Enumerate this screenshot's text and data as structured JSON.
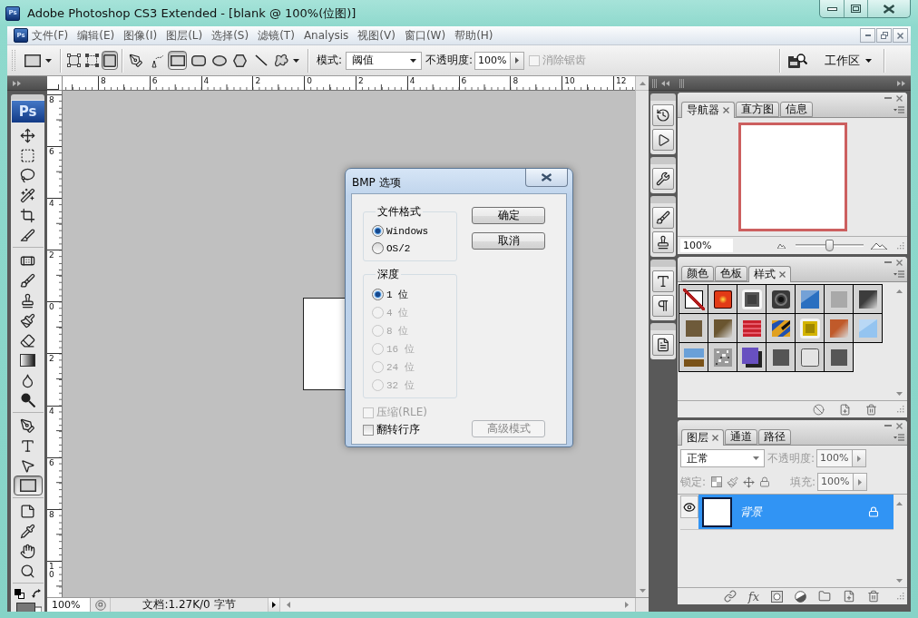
{
  "window": {
    "icon": "Ps",
    "title": "Adobe Photoshop CS3 Extended - [blank @ 100%(位图)]"
  },
  "menu_bar": {
    "icon": "Ps",
    "items": [
      "文件(F)",
      "编辑(E)",
      "图像(I)",
      "图层(L)",
      "选择(S)",
      "滤镜(T)",
      "Analysis",
      "视图(V)",
      "窗口(W)",
      "帮助(H)"
    ]
  },
  "options_bar": {
    "path_modes": [
      {
        "kind": "shape-layers",
        "selected": false
      },
      {
        "kind": "paths",
        "selected": false
      },
      {
        "kind": "fill-pixels",
        "selected": true
      }
    ],
    "shape_tools": [
      {
        "kind": "pen",
        "selected": false
      },
      {
        "kind": "freeform-pen",
        "selected": false
      },
      {
        "kind": "rectangle",
        "selected": true
      },
      {
        "kind": "rounded-rectangle",
        "selected": false
      },
      {
        "kind": "ellipse",
        "selected": false
      },
      {
        "kind": "polygon",
        "selected": false
      },
      {
        "kind": "line",
        "selected": false
      },
      {
        "kind": "custom-shape",
        "selected": false
      }
    ],
    "mode": {
      "label": "模式:",
      "value": "阈值"
    },
    "opacity": {
      "label": "不透明度:",
      "value": "100%"
    },
    "anti_alias": {
      "label": "消除锯齿",
      "checked": false,
      "disabled": true
    },
    "workspace": "工作区"
  },
  "toolbox": {
    "logo": "Ps",
    "groups": [
      {
        "tools": [
          {
            "kind": "move",
            "selected": false
          },
          {
            "kind": "marquee",
            "selected": false
          },
          {
            "kind": "lasso",
            "selected": false
          },
          {
            "kind": "magic-wand",
            "selected": false
          },
          {
            "kind": "crop",
            "selected": false
          },
          {
            "kind": "slice",
            "selected": false
          }
        ]
      },
      {
        "tools": [
          {
            "kind": "heal",
            "selected": false
          },
          {
            "kind": "brush",
            "selected": false
          },
          {
            "kind": "stamp",
            "selected": false
          },
          {
            "kind": "history-brush",
            "selected": false
          },
          {
            "kind": "eraser",
            "selected": false
          },
          {
            "kind": "gradient",
            "selected": false
          },
          {
            "kind": "blur",
            "selected": false
          },
          {
            "kind": "dodge",
            "selected": false
          }
        ]
      },
      {
        "tools": [
          {
            "kind": "pen",
            "selected": false
          },
          {
            "kind": "type",
            "selected": false
          },
          {
            "kind": "path-select",
            "selected": false
          },
          {
            "kind": "shape",
            "selected": true
          }
        ]
      },
      {
        "tools": [
          {
            "kind": "notes",
            "selected": false
          },
          {
            "kind": "eyedropper",
            "selected": false
          },
          {
            "kind": "hand",
            "selected": false
          },
          {
            "kind": "zoom",
            "selected": false
          }
        ]
      }
    ]
  },
  "document": {
    "ruler_h": [
      "8",
      "6",
      "4",
      "2",
      "0",
      "2",
      "4",
      "6",
      "8",
      "10",
      "12"
    ],
    "ruler_v": [
      "8",
      "6",
      "4",
      "2",
      "0",
      "2",
      "4",
      "6",
      "8",
      "10"
    ],
    "zoom": "100%",
    "info": "文档:1.27K/0 字节"
  },
  "dialog": {
    "title": "BMP 选项",
    "file_format": {
      "label": "文件格式",
      "options": [
        {
          "label": "Windows",
          "selected": true,
          "disabled": false
        },
        {
          "label": "OS/2",
          "selected": false,
          "disabled": false
        }
      ]
    },
    "depth": {
      "label": "深度",
      "options": [
        {
          "label": "1 位",
          "selected": true,
          "disabled": false
        },
        {
          "label": "4 位",
          "selected": false,
          "disabled": true
        },
        {
          "label": "8 位",
          "selected": false,
          "disabled": true
        },
        {
          "label": "16 位",
          "selected": false,
          "disabled": true
        },
        {
          "label": "24 位",
          "selected": false,
          "disabled": true
        },
        {
          "label": "32 位",
          "selected": false,
          "disabled": true
        }
      ]
    },
    "checkboxes": [
      {
        "label": "压缩(RLE)",
        "checked": false,
        "disabled": true
      },
      {
        "label": "翻转行序",
        "checked": false,
        "disabled": false
      }
    ],
    "buttons": [
      {
        "label": "确定",
        "disabled": false
      },
      {
        "label": "取消",
        "disabled": false
      }
    ],
    "advanced_button": {
      "label": "高级模式",
      "disabled": true
    }
  },
  "dock": {
    "groups": [
      {
        "items": [
          {
            "kind": "history"
          },
          {
            "kind": "actions"
          }
        ]
      },
      {
        "items": [
          {
            "kind": "tool-presets"
          }
        ]
      },
      {
        "items": [
          {
            "kind": "brushes"
          },
          {
            "kind": "clone-source"
          }
        ]
      },
      {
        "items": [
          {
            "kind": "character"
          },
          {
            "kind": "paragraph"
          }
        ]
      },
      {
        "items": [
          {
            "kind": "layer-comps"
          }
        ]
      }
    ]
  },
  "navigator": {
    "tabs": [
      {
        "label": "导航器",
        "selected": true
      },
      {
        "label": "直方图",
        "selected": false
      },
      {
        "label": "信息",
        "selected": false
      }
    ],
    "zoom": "100%",
    "zoom_slider": {
      "level": 0.49
    }
  },
  "styles_panel": {
    "tabs": [
      {
        "label": "颜色",
        "selected": false
      },
      {
        "label": "色板",
        "selected": false
      },
      {
        "label": "样式",
        "selected": true
      }
    ],
    "styles": [
      {
        "kind": "none",
        "color": "#b01c1c"
      },
      {
        "kind": "glow",
        "color": "#e23a16"
      },
      {
        "kind": "framed",
        "color": "#555555"
      },
      {
        "kind": "ring",
        "color": "#3a3a3a"
      },
      {
        "kind": "gloss",
        "color": "#2a6fc0"
      },
      {
        "kind": "flat",
        "color": "#a9a9a9"
      },
      {
        "kind": "fade",
        "color": "#3c3c3c"
      },
      {
        "kind": "flat",
        "color": "#6e5a3a"
      },
      {
        "kind": "fade",
        "color": "#6a5530"
      },
      {
        "kind": "striped",
        "color": "#c8202c"
      },
      {
        "kind": "mixed",
        "color": "#e0a020"
      },
      {
        "kind": "framed",
        "color": "#d4b400"
      },
      {
        "kind": "fade",
        "color": "#c05a2a"
      },
      {
        "kind": "gloss",
        "color": "#94c4f0"
      },
      {
        "kind": "landscape",
        "color": "#6aa0d8"
      },
      {
        "kind": "noise",
        "color": "#9a9a9a"
      },
      {
        "kind": "shadow",
        "color": "#6850c0"
      },
      {
        "kind": "flat",
        "color": "#555555"
      },
      {
        "kind": "outline",
        "color": "#e4e4e4"
      },
      {
        "kind": "flat",
        "color": "#565656"
      }
    ]
  },
  "layers_panel": {
    "tabs": [
      {
        "label": "图层",
        "selected": true
      },
      {
        "label": "通道",
        "selected": false
      },
      {
        "label": "路径",
        "selected": false
      }
    ],
    "blend_mode": "正常",
    "opacity": {
      "label": "不透明度:",
      "value": "100%",
      "disabled": true
    },
    "lock": {
      "label": "锁定:",
      "disabled": true
    },
    "fill": {
      "label": "填充:",
      "value": "100%",
      "disabled": true
    },
    "layers": [
      {
        "name": "背景",
        "visible": true,
        "selected": true,
        "locked": true
      }
    ],
    "footer": [
      {
        "kind": "link"
      },
      {
        "kind": "text",
        "label": "fx"
      },
      {
        "kind": "mask"
      },
      {
        "kind": "adjustment"
      },
      {
        "kind": "folder"
      },
      {
        "kind": "new"
      },
      {
        "kind": "trash"
      }
    ]
  }
}
